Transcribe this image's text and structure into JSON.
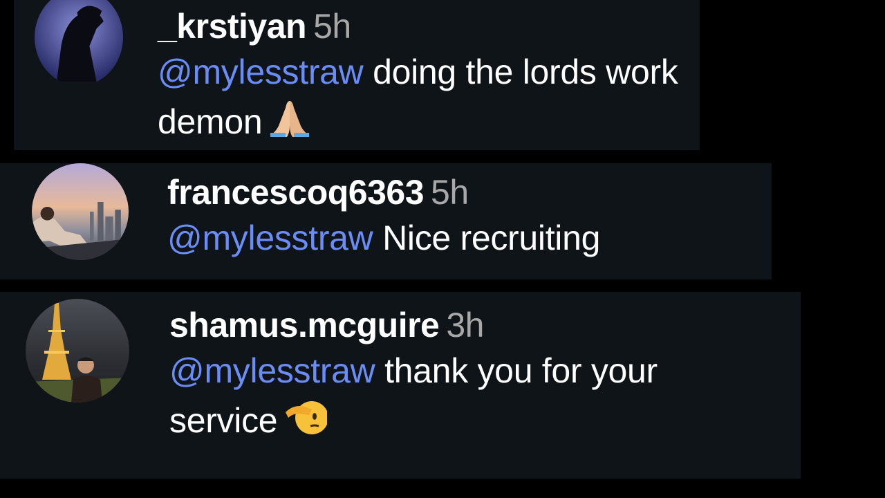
{
  "comments": [
    {
      "username": "_krstiyan",
      "time": "5h",
      "mention": "@mylesstraw",
      "text": " doing the lords work demon",
      "emoji": "folded-hands"
    },
    {
      "username": "francescoq6363",
      "time": "5h",
      "mention": "@mylesstraw",
      "text": " Nice recruiting"
    },
    {
      "username": "shamus.mcguire",
      "time": "3h",
      "mention": "@mylesstraw",
      "text": " thank you for your service",
      "emoji": "saluting-face"
    }
  ],
  "colors": {
    "background": "#000000",
    "comment_bg": "#0f1419",
    "mention": "#6b8cf5",
    "timestamp": "#a8a8a8",
    "text": "#ffffff"
  }
}
